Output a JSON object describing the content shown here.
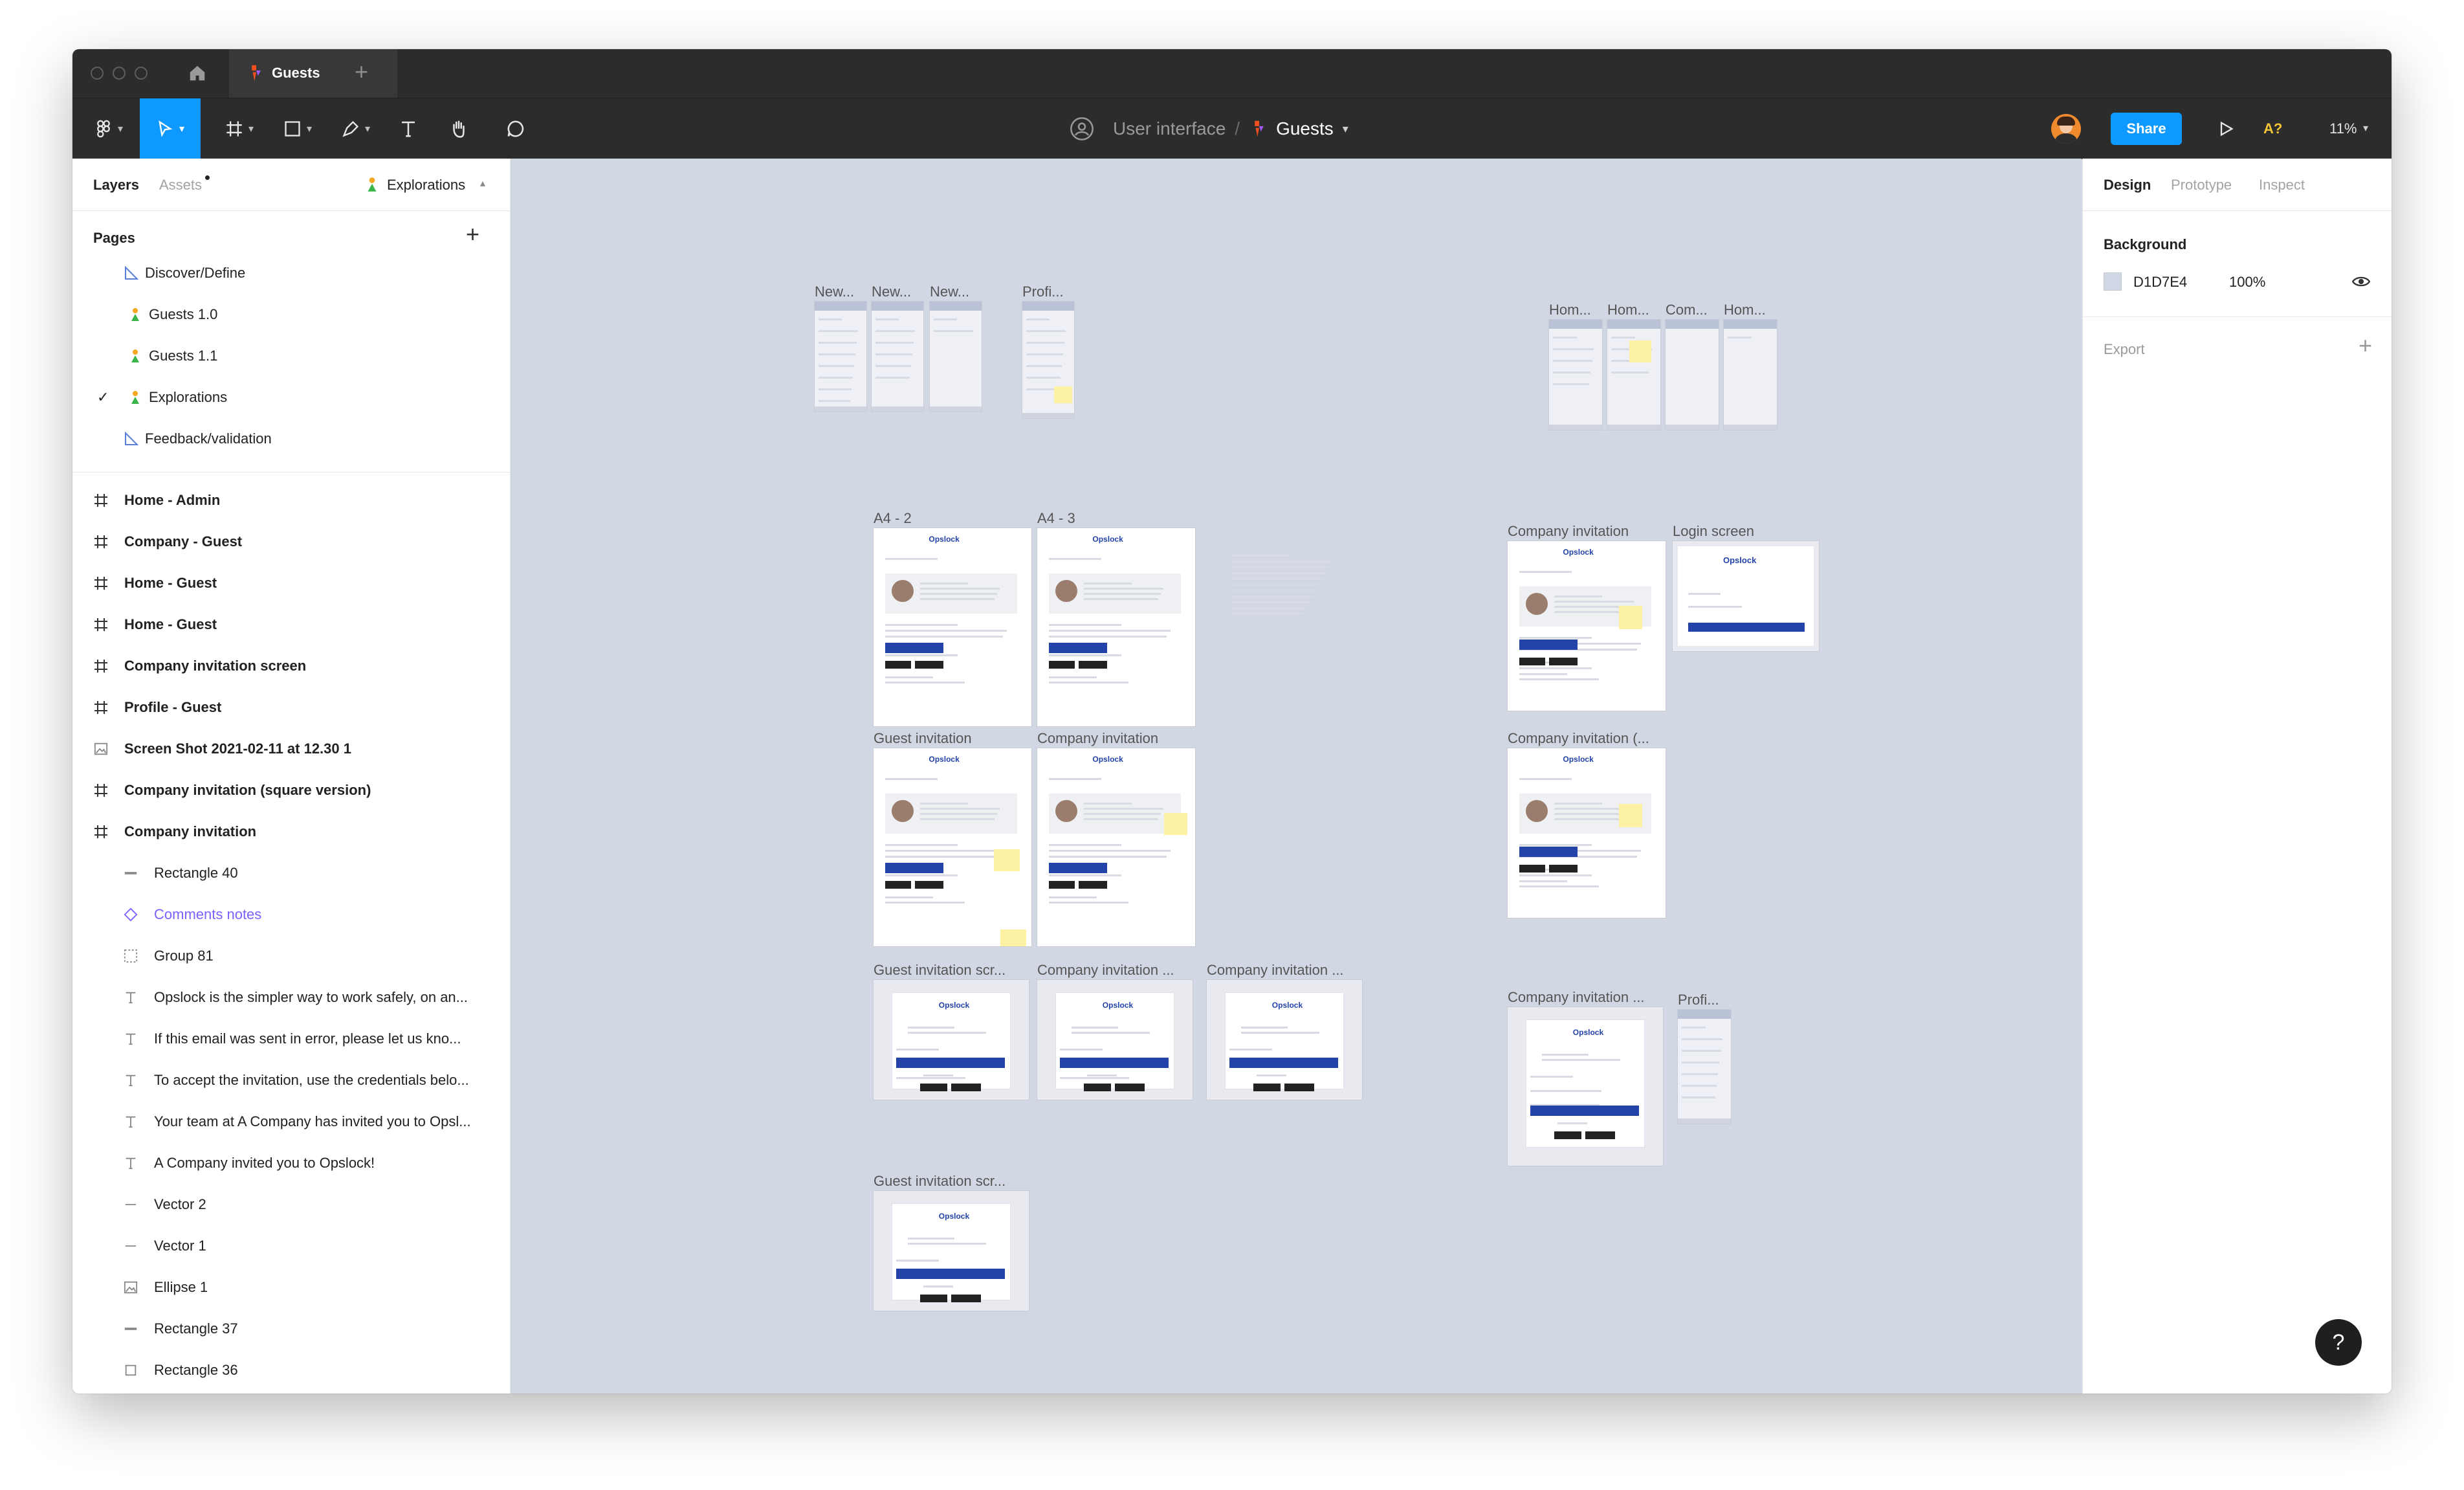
{
  "window": {
    "tab_title": "Guests",
    "new_tab": "+"
  },
  "toolbar": {
    "project": "User interface",
    "separator": "/",
    "file": "Guests",
    "share_label": "Share",
    "accessibility_label": "A?",
    "zoom": "11%"
  },
  "left_panel": {
    "tabs": {
      "layers": "Layers",
      "assets": "Assets",
      "page_selector": "Explorations"
    },
    "pages_heading": "Pages",
    "add_page": "+",
    "pages": [
      {
        "label": "Discover/Define",
        "icon": "ruler-icon"
      },
      {
        "label": "Guests 1.0",
        "icon": "person-icon"
      },
      {
        "label": "Guests 1.1",
        "icon": "person-icon"
      },
      {
        "label": "Explorations",
        "icon": "person-icon",
        "selected": true
      },
      {
        "label": "Feedback/validation",
        "icon": "ruler-icon"
      }
    ],
    "layers": [
      {
        "label": "Home - Admin",
        "type": "frame",
        "indent": 0
      },
      {
        "label": "Company - Guest",
        "type": "frame",
        "indent": 0
      },
      {
        "label": "Home - Guest",
        "type": "frame",
        "indent": 0
      },
      {
        "label": "Home - Guest",
        "type": "frame",
        "indent": 0
      },
      {
        "label": "Company invitation screen",
        "type": "frame",
        "indent": 0
      },
      {
        "label": "Profile - Guest",
        "type": "frame",
        "indent": 0
      },
      {
        "label": "Screen Shot 2021-02-11 at 12.30 1",
        "type": "image",
        "indent": 0
      },
      {
        "label": "Company invitation (square version)",
        "type": "frame",
        "indent": 0
      },
      {
        "label": "Company invitation",
        "type": "frame",
        "indent": 0
      },
      {
        "label": "Rectangle 40",
        "type": "rect",
        "indent": 1
      },
      {
        "label": "Comments notes",
        "type": "component",
        "indent": 1
      },
      {
        "label": "Group 81",
        "type": "group",
        "indent": 1
      },
      {
        "label": "Opslock is the simpler way to work safely, on an...",
        "type": "text",
        "indent": 1
      },
      {
        "label": "If this email was sent in error, please let us kno...",
        "type": "text",
        "indent": 1
      },
      {
        "label": "To accept the invitation, use the credentials belo...",
        "type": "text",
        "indent": 1
      },
      {
        "label": "Your team at A Company has invited you to Opsl...",
        "type": "text",
        "indent": 1
      },
      {
        "label": "A Company invited you to Opslock!",
        "type": "text",
        "indent": 1
      },
      {
        "label": "Vector 2",
        "type": "vector",
        "indent": 1
      },
      {
        "label": "Vector 1",
        "type": "vector",
        "indent": 1
      },
      {
        "label": "Ellipse 1",
        "type": "image",
        "indent": 1
      },
      {
        "label": "Rectangle 37",
        "type": "rect",
        "indent": 1
      },
      {
        "label": "Rectangle 36",
        "type": "square",
        "indent": 1
      }
    ]
  },
  "right_panel": {
    "tabs": {
      "design": "Design",
      "prototype": "Prototype",
      "inspect": "Inspect"
    },
    "background_heading": "Background",
    "background_hex": "D1D7E4",
    "background_opacity": "100%",
    "export_heading": "Export",
    "add_export": "+"
  },
  "canvas": {
    "background_color": "#d2d7e4",
    "frame_labels": {
      "new1": "New...",
      "new2": "New...",
      "new3": "New...",
      "profi1": "Profi...",
      "hom1": "Hom...",
      "hom2": "Hom...",
      "com1": "Com...",
      "hom3": "Hom...",
      "a4_2": "A4 - 2",
      "a4_3": "A4 - 3",
      "guest_inv": "Guest invitation",
      "company_inv1": "Company invitation",
      "company_inv2": "Company invitation",
      "login": "Login screen",
      "company_inv_sq": "Company invitation (...",
      "guest_scr1": "Guest invitation scr...",
      "company_inv3": "Company invitation ...",
      "company_inv4": "Company invitation ...",
      "guest_scr2": "Guest invitation scr...",
      "company_inv5": "Company invitation ...",
      "profi2": "Profi..."
    },
    "logo_text": "Opslock"
  },
  "help": "?"
}
